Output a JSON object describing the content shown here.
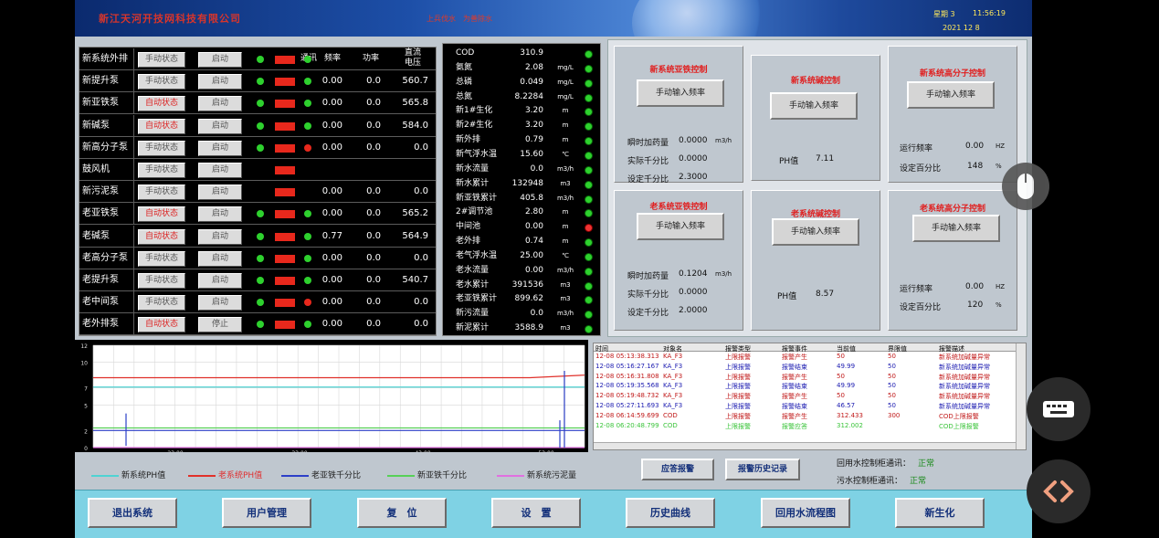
{
  "header": {
    "company": "新江天河开技网科技有限公司",
    "slogan": "上兵伐水　为善除水",
    "weekday": "星期 3",
    "time": "11:56:19",
    "date": "2021  12  8"
  },
  "pumps_header": {
    "comm": "通讯",
    "freq": "频率",
    "power": "功率",
    "voltage_line1": "直流",
    "voltage_line2": "电压"
  },
  "pumps": [
    {
      "name": "新系统外排",
      "mode": "手动状态",
      "start": "启动",
      "freq": "",
      "power": "",
      "voltage": ""
    },
    {
      "name": "新提升泵",
      "mode": "手动状态",
      "start": "启动",
      "freq": "0.00",
      "power": "0.0",
      "voltage": "560.7"
    },
    {
      "name": "新亚铁泵",
      "mode": "自动状态",
      "start": "启动",
      "freq": "0.00",
      "power": "0.0",
      "voltage": "565.8"
    },
    {
      "name": "新碱泵",
      "mode": "自动状态",
      "start": "启动",
      "freq": "0.00",
      "power": "0.0",
      "voltage": "584.0"
    },
    {
      "name": "新高分子泵",
      "mode": "手动状态",
      "start": "启动",
      "freq": "0.00",
      "power": "0.0",
      "voltage": "0.0"
    },
    {
      "name": "鼓风机",
      "mode": "手动状态",
      "start": "启动",
      "freq": "",
      "power": "",
      "voltage": ""
    },
    {
      "name": "新污泥泵",
      "mode": "手动状态",
      "start": "启动",
      "freq": "0.00",
      "power": "0.0",
      "voltage": "0.0"
    },
    {
      "name": "老亚铁泵",
      "mode": "自动状态",
      "start": "启动",
      "freq": "0.00",
      "power": "0.0",
      "voltage": "565.2"
    },
    {
      "name": "老碱泵",
      "mode": "自动状态",
      "start": "启动",
      "freq": "0.77",
      "power": "0.0",
      "voltage": "564.9"
    },
    {
      "name": "老高分子泵",
      "mode": "手动状态",
      "start": "启动",
      "freq": "0.00",
      "power": "0.0",
      "voltage": "0.0"
    },
    {
      "name": "老提升泵",
      "mode": "手动状态",
      "start": "启动",
      "freq": "0.00",
      "power": "0.0",
      "voltage": "540.7"
    },
    {
      "name": "老中间泵",
      "mode": "手动状态",
      "start": "启动",
      "freq": "0.00",
      "power": "0.0",
      "voltage": "0.0"
    },
    {
      "name": "老外排泵",
      "mode": "自动状态",
      "start": "停止",
      "freq": "0.00",
      "power": "0.0",
      "voltage": "0.0"
    }
  ],
  "params": [
    {
      "label": "COD",
      "value": "310.9",
      "unit": ""
    },
    {
      "label": "氨氮",
      "value": "2.08",
      "unit": "mg/L"
    },
    {
      "label": "总磷",
      "value": "0.049",
      "unit": "mg/L"
    },
    {
      "label": "总氮",
      "value": "8.2284",
      "unit": "mg/L"
    },
    {
      "label": "新1#生化",
      "value": "3.20",
      "unit": "m"
    },
    {
      "label": "新2#生化",
      "value": "3.20",
      "unit": "m"
    },
    {
      "label": "新外排",
      "value": "0.79",
      "unit": "m"
    },
    {
      "label": "新气浮水温",
      "value": "15.60",
      "unit": "℃"
    },
    {
      "label": "新水流量",
      "value": "0.0",
      "unit": "m3/h"
    },
    {
      "label": "新水累计",
      "value": "132948",
      "unit": "m3"
    },
    {
      "label": "新亚铁累计",
      "value": "405.8",
      "unit": "m3/h"
    },
    {
      "label": "2#调节池",
      "value": "2.80",
      "unit": "m"
    },
    {
      "label": "中间池",
      "value": "0.00",
      "unit": "m"
    },
    {
      "label": "老外排",
      "value": "0.74",
      "unit": "m"
    },
    {
      "label": "老气浮水温",
      "value": "25.00",
      "unit": "℃"
    },
    {
      "label": "老水流量",
      "value": "0.00",
      "unit": "m3/h"
    },
    {
      "label": "老水累计",
      "value": "391536",
      "unit": "m3"
    },
    {
      "label": "老亚铁累计",
      "value": "899.62",
      "unit": "m3"
    },
    {
      "label": "新污流量",
      "value": "0.0",
      "unit": "m3/h"
    },
    {
      "label": "新泥累计",
      "value": "3588.9",
      "unit": "m3"
    }
  ],
  "panels": {
    "new_fe": {
      "title": "新系统亚铁控制",
      "button": "手动输入频率",
      "l1": "瞬时加药量",
      "v1": "0.0000",
      "u1": "m3/h",
      "l2": "实际千分比",
      "v2": "0.0000",
      "l3": "设定千分比",
      "v3": "2.3000"
    },
    "new_alkali": {
      "title": "新系统碱控制",
      "button": "手动输入频率",
      "ph_label": "PH值",
      "ph_value": "7.11"
    },
    "new_poly": {
      "title": "新系统高分子控制",
      "button": "手动输入频率",
      "l1": "运行频率",
      "v1": "0.00",
      "u1": "HZ",
      "l2": "设定百分比",
      "v2": "148",
      "u2": "%"
    },
    "old_fe": {
      "title": "老系统亚铁控制",
      "button": "手动输入频率",
      "l1": "瞬时加药量",
      "v1": "0.1204",
      "u1": "m3/h",
      "l2": "实际千分比",
      "v2": "0.0000",
      "l3": "设定千分比",
      "v3": "2.0000"
    },
    "old_alkali": {
      "title": "老系统碱控制",
      "button": "手动输入频率",
      "ph_label": "PH值",
      "ph_value": "8.57"
    },
    "old_poly": {
      "title": "老系统高分子控制",
      "button": "手动输入频率",
      "l1": "运行频率",
      "v1": "0.00",
      "u1": "HZ",
      "l2": "设定百分比",
      "v2": "120",
      "u2": "%"
    }
  },
  "chart_data": {
    "type": "line",
    "ylim": [
      0,
      12
    ],
    "yticks": [
      "12",
      "10",
      "7",
      "5",
      "2",
      "0"
    ],
    "xticks": [
      "23:00",
      "33:00",
      "43:00",
      "53:00"
    ],
    "series": [
      {
        "name": "新系统PH值",
        "color": "#4fd3d3",
        "values": [
          7.1,
          7.1,
          7.1,
          7.1,
          7.1,
          7.1,
          7.1,
          7.1,
          7.1,
          7.1
        ]
      },
      {
        "name": "老系统PH值",
        "color": "#e0302a",
        "values": [
          8.2,
          8.2,
          8.2,
          8.2,
          8.2,
          8.2,
          8.2,
          8.2,
          8.2,
          8.5
        ]
      },
      {
        "name": "老亚铁千分比",
        "color": "#2c3fc8",
        "values": [
          2.0,
          2.0,
          2.0,
          2.0,
          2.0,
          2.0,
          2.0,
          2.0,
          2.0,
          2.0
        ]
      },
      {
        "name": "新亚铁千分比",
        "color": "#57d057",
        "values": [
          2.3,
          2.3,
          2.3,
          2.3,
          2.3,
          2.3,
          2.3,
          2.3,
          2.3,
          2.3
        ]
      },
      {
        "name": "新系统污泥量",
        "color": "#e070e0",
        "values": [
          0,
          0,
          0,
          0,
          0,
          0,
          0,
          0,
          0,
          0
        ]
      }
    ]
  },
  "alarm": {
    "headers": [
      "时间",
      "对象名",
      "报警类型",
      "报警事件",
      "当前值",
      "界限值",
      "报警描述"
    ],
    "rows": [
      {
        "time": "12-08 05:13:38.313",
        "obj": "KA_F3",
        "type": "上限报警",
        "event": "报警产生",
        "cur": "50",
        "lim": "50",
        "desc": "新系统加碱量异常",
        "color": "#c01818"
      },
      {
        "time": "12-08 05:16:27.167",
        "obj": "KA_F3",
        "type": "上限报警",
        "event": "报警结束",
        "cur": "49.99",
        "lim": "50",
        "desc": "新系统加碱量异常",
        "color": "#1a1ab0"
      },
      {
        "time": "12-08 05:16:31.808",
        "obj": "KA_F3",
        "type": "上限报警",
        "event": "报警产生",
        "cur": "50",
        "lim": "50",
        "desc": "新系统加碱量异常",
        "color": "#c01818"
      },
      {
        "time": "12-08 05:19:35.568",
        "obj": "KA_F3",
        "type": "上限报警",
        "event": "报警结束",
        "cur": "49.99",
        "lim": "50",
        "desc": "新系统加碱量异常",
        "color": "#1a1ab0"
      },
      {
        "time": "12-08 05:19:48.732",
        "obj": "KA_F3",
        "type": "上限报警",
        "event": "报警产生",
        "cur": "50",
        "lim": "50",
        "desc": "新系统加碱量异常",
        "color": "#c01818"
      },
      {
        "time": "12-08 05:27:11.693",
        "obj": "KA_F3",
        "type": "上限报警",
        "event": "报警结束",
        "cur": "46.57",
        "lim": "50",
        "desc": "新系统加碱量异常",
        "color": "#1a1ab0"
      },
      {
        "time": "12-08 06:14:59.699",
        "obj": "COD",
        "type": "上限报警",
        "event": "报警产生",
        "cur": "312.433",
        "lim": "300",
        "desc": "COD上限报警",
        "color": "#c01818"
      },
      {
        "time": "12-08 06:20:48.799",
        "obj": "COD",
        "type": "上限报警",
        "event": "报警应答",
        "cur": "312.002",
        "lim": "",
        "desc": "COD上限报警",
        "color": "#3ac43a"
      }
    ]
  },
  "actions": {
    "ack": "应答报警",
    "history": "报警历史记录",
    "comm1_label": "回用水控制柜通讯：",
    "comm1_value": "正常",
    "comm2_label": "污水控制柜通讯：",
    "comm2_value": "正常"
  },
  "nav": [
    "退出系统",
    "用户管理",
    "复　位",
    "设　置",
    "历史曲线",
    "回用水流程图",
    "新生化"
  ]
}
